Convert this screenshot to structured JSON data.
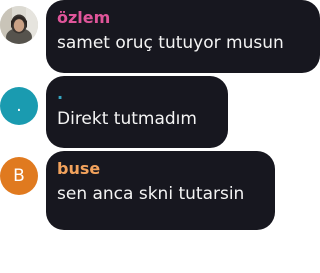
{
  "messages": [
    {
      "sender": "özlem",
      "text": "samet oruç tutuyor musun",
      "sender_color": "#e0559a",
      "avatar": {
        "type": "photo",
        "icon": "user-photo-avatar",
        "color": "#d9d7cf"
      }
    },
    {
      "sender": ".",
      "text": "Direkt tutmadım",
      "sender_color": "#35a7c2",
      "avatar": {
        "type": "initial",
        "initial": ".",
        "color": "#1a9bb0"
      }
    },
    {
      "sender": "buse",
      "text": "sen anca skni tutarsin",
      "sender_color": "#f2a25c",
      "avatar": {
        "type": "initial",
        "initial": "B",
        "color": "#e07a1f"
      }
    }
  ],
  "colors": {
    "bubble": "#17171f",
    "message_text": "#f4f4f4",
    "background": "#ffffff"
  }
}
